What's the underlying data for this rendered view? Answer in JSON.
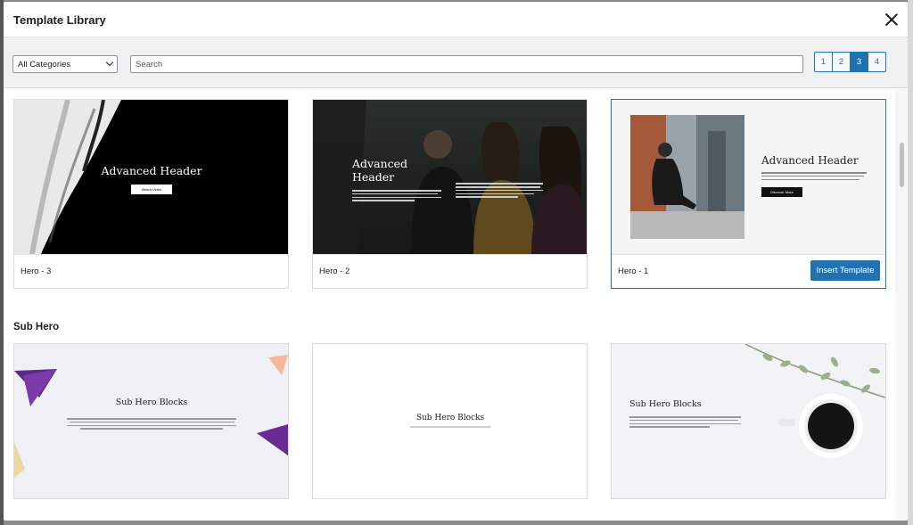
{
  "modal": {
    "title": "Template Library"
  },
  "toolbar": {
    "category_value": "All Categories",
    "search_placeholder": "Search",
    "pages": [
      "1",
      "2",
      "3",
      "4"
    ],
    "active_page": "3"
  },
  "templates": [
    {
      "label": "Hero - 3",
      "heading": "Advanced Header",
      "button": "Watch Video"
    },
    {
      "label": "Hero - 2",
      "heading": "Advanced Header"
    },
    {
      "label": "Hero - 1",
      "heading": "Advanced Header",
      "button": "Discover More",
      "action": "Insert Template"
    }
  ],
  "section": {
    "title": "Sub Hero"
  },
  "sub_templates": [
    {
      "heading": "Sub Hero Blocks"
    },
    {
      "heading": "Sub Hero Blocks"
    },
    {
      "heading": "Sub Hero Blocks"
    }
  ],
  "colors": {
    "accent": "#2271b1",
    "toolbar_bg": "#f0f0f1"
  }
}
